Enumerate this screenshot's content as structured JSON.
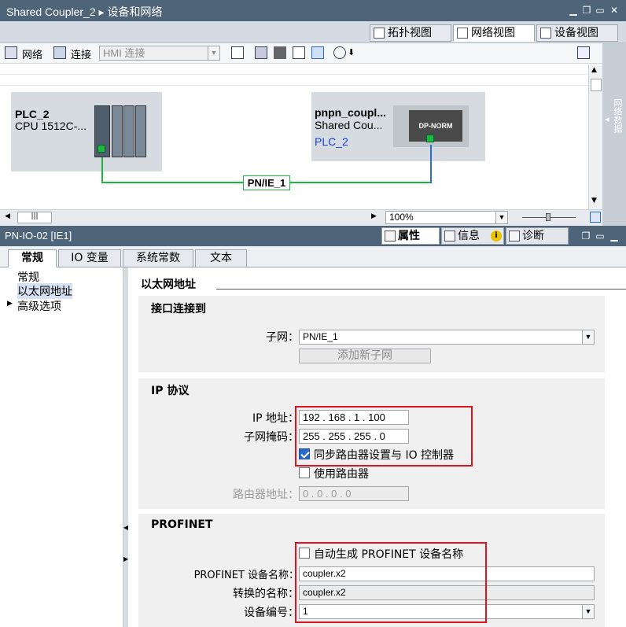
{
  "window": {
    "title": "Shared Coupler_2",
    "breadcrumb_sep": "▸",
    "section": "设备和网络"
  },
  "view_tabs": [
    {
      "label": "拓扑视图"
    },
    {
      "label": "网络视图"
    },
    {
      "label": "设备视图"
    }
  ],
  "toolbar": {
    "network_label": "网络",
    "connect_label": "连接",
    "connection_type": "HMI 连接"
  },
  "canvas": {
    "plc": {
      "name": "PLC_2",
      "cpu": "CPU 1512C-..."
    },
    "coupler": {
      "name": "pnpn_coupl...",
      "type": "Shared Cou...",
      "link": "PLC_2",
      "module_label": "DP-NORM"
    },
    "subnet_label": "PN/IE_1",
    "zoom": "100%",
    "side_panel_label": "网络数据"
  },
  "inspector": {
    "title": "PN-IO-02 [IE1]",
    "tabs": [
      {
        "label": "属性"
      },
      {
        "label": "信息"
      },
      {
        "label": "诊断"
      }
    ],
    "subtabs": [
      {
        "label": "常规"
      },
      {
        "label": "IO 变量"
      },
      {
        "label": "系统常数"
      },
      {
        "label": "文本"
      }
    ]
  },
  "nav": {
    "items": [
      {
        "label": "常规"
      },
      {
        "label": "以太网地址"
      },
      {
        "label": "高级选项"
      }
    ]
  },
  "content": {
    "heading": "以太网地址",
    "interface": {
      "title": "接口连接到",
      "subnet_label": "子网：",
      "subnet_value": "PN/IE_1",
      "add_subnet_label": "添加新子网"
    },
    "ip": {
      "title": "IP 协议",
      "ip_label": "IP 地址：",
      "ip_value": "192 . 168 . 1    . 100",
      "mask_label": "子网掩码：",
      "mask_value": "255 . 255 . 255 . 0",
      "sync_router_label": "同步路由器设置与 IO 控制器",
      "use_router_label": "使用路由器",
      "router_addr_label": "路由器地址：",
      "router_addr_value": "0    . 0    . 0    . 0"
    },
    "profinet": {
      "title": "PROFINET",
      "auto_name_label": "自动生成 PROFINET 设备名称",
      "device_name_label": "PROFINET 设备名称：",
      "device_name_value": "coupler.x2",
      "converted_name_label": "转换的名称：",
      "converted_name_value": "coupler.x2",
      "device_number_label": "设备编号：",
      "device_number_value": "1"
    }
  },
  "colors": {
    "title_bar": "#4e6479",
    "highlight_red": "#e0141e",
    "subnet_green": "#1db83a"
  }
}
